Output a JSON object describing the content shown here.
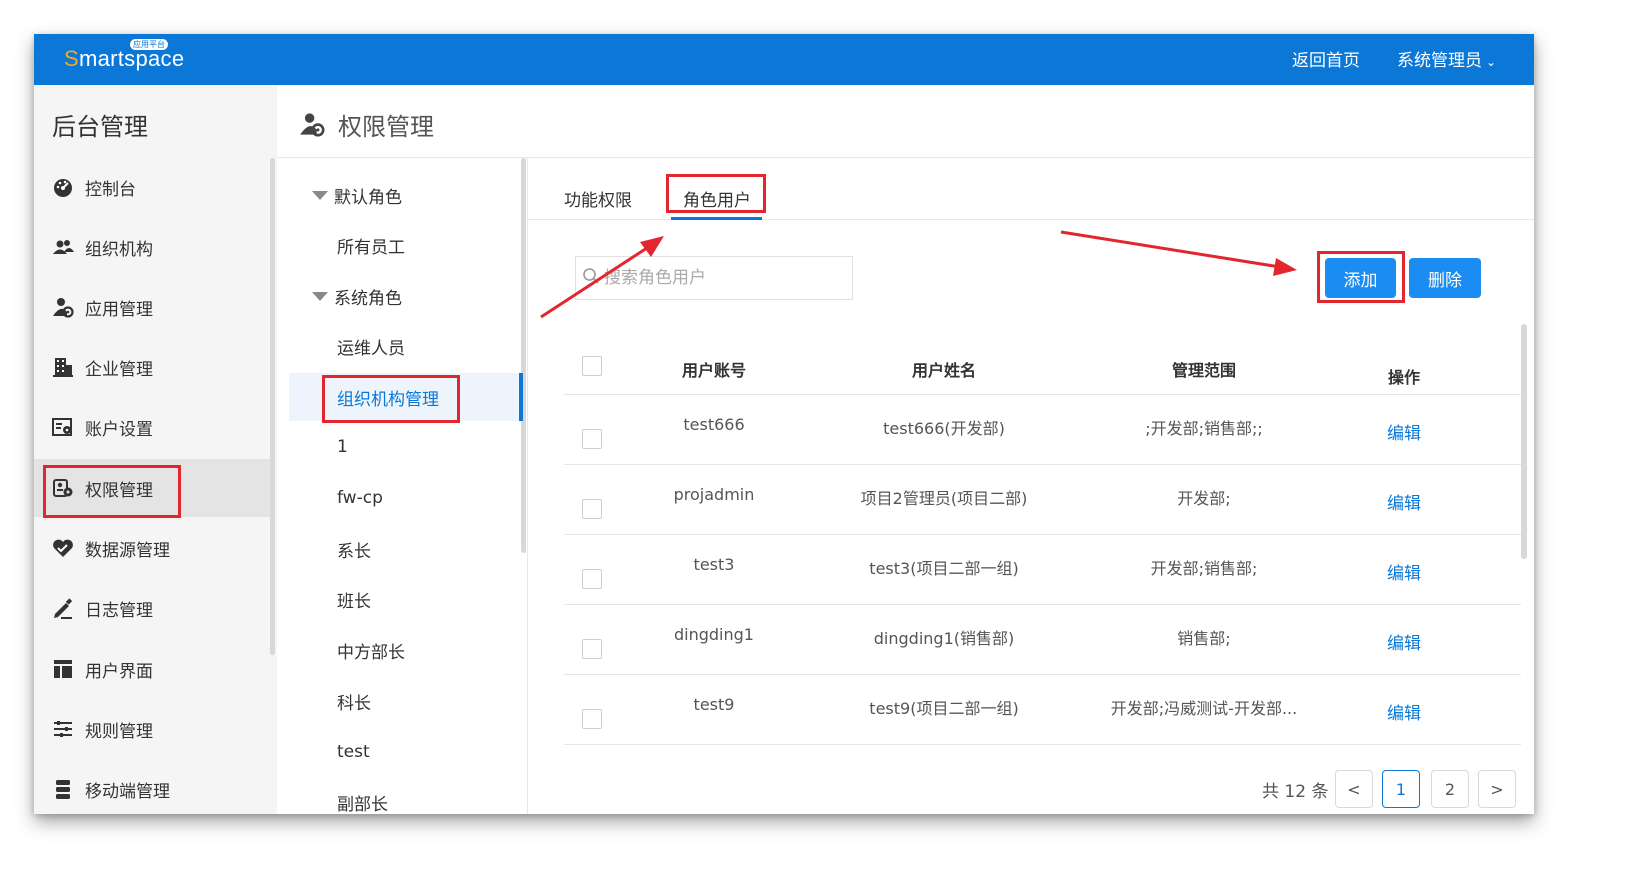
{
  "topbar": {
    "logo_text": "Smartspace",
    "logo_badge": "应用平台",
    "home_link": "返回首页",
    "user_menu": "系统管理员",
    "accent": "#0b78d7"
  },
  "sidebar": {
    "title": "后台管理",
    "items": [
      {
        "label": "控制台",
        "icon": "dashboard-icon"
      },
      {
        "label": "组织机构",
        "icon": "users-icon"
      },
      {
        "label": "应用管理",
        "icon": "user-gear-icon"
      },
      {
        "label": "企业管理",
        "icon": "building-icon"
      },
      {
        "label": "账户设置",
        "icon": "account-settings-icon"
      },
      {
        "label": "权限管理",
        "icon": "permission-icon",
        "active": true
      },
      {
        "label": "数据源管理",
        "icon": "datasource-icon"
      },
      {
        "label": "日志管理",
        "icon": "pen-icon"
      },
      {
        "label": "用户界面",
        "icon": "layout-icon"
      },
      {
        "label": "规则管理",
        "icon": "sliders-icon"
      },
      {
        "label": "移动端管理",
        "icon": "database-icon"
      }
    ]
  },
  "content": {
    "title": "权限管理"
  },
  "role_tree": {
    "items": [
      {
        "label": "默认角色",
        "type": "group"
      },
      {
        "label": "所有员工",
        "type": "leaf"
      },
      {
        "label": "系统角色",
        "type": "group"
      },
      {
        "label": "运维人员",
        "type": "leaf"
      },
      {
        "label": "组织机构管理",
        "type": "leaf",
        "selected": true
      },
      {
        "label": "1",
        "type": "leaf"
      },
      {
        "label": "fw-cp",
        "type": "leaf"
      },
      {
        "label": "系长",
        "type": "leaf"
      },
      {
        "label": "班长",
        "type": "leaf"
      },
      {
        "label": "中方部长",
        "type": "leaf"
      },
      {
        "label": "科长",
        "type": "leaf"
      },
      {
        "label": "test",
        "type": "leaf"
      },
      {
        "label": "副部长",
        "type": "leaf"
      }
    ]
  },
  "tabs": [
    {
      "label": "功能权限",
      "active": false
    },
    {
      "label": "角色用户",
      "active": true
    }
  ],
  "search": {
    "placeholder": "搜索角色用户"
  },
  "buttons": {
    "add": "添加",
    "delete": "删除"
  },
  "table": {
    "headers": [
      "用户账号",
      "用户姓名",
      "管理范围",
      "操作"
    ],
    "rows": [
      {
        "account": "test666",
        "name": "test666(开发部)",
        "scope": ";开发部;销售部;;",
        "action": "编辑"
      },
      {
        "account": "projadmin",
        "name": "项目2管理员(项目二部)",
        "scope": "开发部;",
        "action": "编辑"
      },
      {
        "account": "test3",
        "name": "test3(项目二部一组)",
        "scope": "开发部;销售部;",
        "action": "编辑"
      },
      {
        "account": "dingding1",
        "name": "dingding1(销售部)",
        "scope": "销售部;",
        "action": "编辑"
      },
      {
        "account": "test9",
        "name": "test9(项目二部一组)",
        "scope": "开发部;冯威测试-开发部...",
        "action": "编辑"
      }
    ]
  },
  "pagination": {
    "total_text": "共 12 条",
    "pages": [
      "1",
      "2"
    ],
    "current": "1",
    "prev": "<",
    "next": ">"
  },
  "annotation_color": "#e3262e"
}
